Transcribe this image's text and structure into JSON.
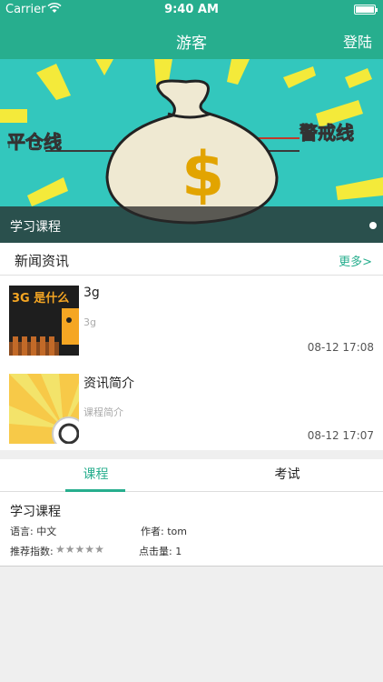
{
  "status_bar": {
    "carrier": "Carrier",
    "time": "9:40 AM"
  },
  "nav": {
    "title": "游客",
    "login": "登陆"
  },
  "banner": {
    "caption": "学习课程",
    "image_text_left": "平仓线",
    "image_text_right": "警戒线",
    "image_symbol": "$"
  },
  "news": {
    "header": "新闻资讯",
    "more": "更多>",
    "items": [
      {
        "title": "3g",
        "summary": "3g",
        "date": "08-12 17:08",
        "thumb_text": "3G 是什么"
      },
      {
        "title": "资讯简介",
        "summary": "课程简介",
        "date": "08-12 17:07"
      }
    ]
  },
  "tabs": [
    {
      "label": "课程",
      "active": true
    },
    {
      "label": "考试",
      "active": false
    }
  ],
  "course": {
    "name": "学习课程",
    "language": "语言: 中文",
    "author": "作者: tom",
    "rating_label": "推荐指数:",
    "rating": 0,
    "rating_max": 5,
    "clicks": "点击量: 1"
  },
  "colors": {
    "accent": "#27ae8e"
  }
}
